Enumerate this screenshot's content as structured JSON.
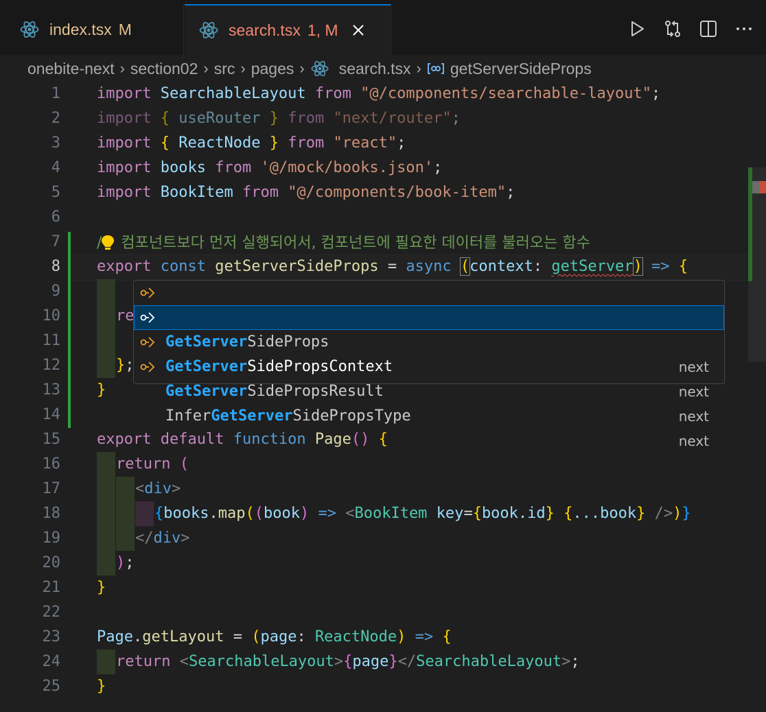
{
  "tabs": [
    {
      "name": "index.tsx",
      "status": "M"
    },
    {
      "name": "search.tsx",
      "status": "1, M"
    }
  ],
  "breadcrumb": [
    "onebite-next",
    "section02",
    "src",
    "pages",
    "search.tsx",
    "getServerSideProps"
  ],
  "editor": {
    "line_numbers": [
      "1",
      "2",
      "3",
      "4",
      "5",
      "6",
      "7",
      "8",
      "9",
      "10",
      "11",
      "12",
      "13",
      "14",
      "15",
      "16",
      "17",
      "18",
      "19",
      "20",
      "21",
      "22",
      "23",
      "24",
      "25"
    ],
    "line1": {
      "kw": "import",
      "name": "SearchableLayout",
      "from": "from",
      "path": "\"@/components/searchable-layout\"",
      "semi": ";"
    },
    "line2": {
      "kw": "import",
      "open": "{",
      "name": "useRouter",
      "close": "}",
      "from": "from",
      "path": "\"next/router\"",
      "semi": ";"
    },
    "line3": {
      "kw": "import",
      "open": "{",
      "name": "ReactNode",
      "close": "}",
      "from": "from",
      "path": "\"react\"",
      "semi": ";"
    },
    "line4": {
      "kw": "import",
      "name": "books",
      "from": "from",
      "path": "'@/mock/books.json'",
      "semi": ";"
    },
    "line5": {
      "kw": "import",
      "name": "BookItem",
      "from": "from",
      "path": "\"@/components/book-item\"",
      "semi": ";"
    },
    "line7": {
      "comment_prefix": "/",
      "comment": "컴포넌트보다 먼저 실행되어서, 컴포넌트에 필요한 데이터를 불러오는 함수"
    },
    "line8": {
      "export": "export",
      "const": "const",
      "name": "getServerSideProps",
      "eq": "=",
      "async": "async",
      "open": "(",
      "param": "context",
      "colon": ":",
      "typed": "getServer",
      "close": ")",
      "arrow": "=>",
      "brace": "{"
    },
    "line10": {
      "text": "re"
    },
    "line12": {
      "brace": "}",
      "semi": ";"
    },
    "line13": {
      "brace": "}"
    },
    "line15": {
      "export": "export",
      "default": "default",
      "function": "function",
      "name": "Page",
      "parens": "()",
      "brace": "{"
    },
    "line16": {
      "ret": "return",
      "open": "("
    },
    "line17": {
      "lt": "<",
      "tag": "div",
      "gt": ">"
    },
    "line18": {
      "ob": "{",
      "books": "books",
      "dot": ".",
      "map": "map",
      "p1": "(",
      "p2": "(",
      "book": "book",
      "p3": ")",
      "arrow": "=>",
      "lt": "<",
      "comp": "BookItem",
      "attr": "key",
      "eq": "=",
      "ob2": "{",
      "bid": "book.id",
      "cb2": "}",
      "ob3": "{",
      "spread": "...book",
      "cb3": "}",
      "selfclose": "/>",
      "p4": ")",
      "cb": "}"
    },
    "line19": {
      "open": "</",
      "tag": "div",
      "gt": ">"
    },
    "line20": {
      "close": ")",
      "semi": ";"
    },
    "line21": {
      "brace": "}"
    },
    "line23": {
      "obj": "Page",
      "dot": ".",
      "prop": "getLayout",
      "eq": "=",
      "open": "(",
      "param": "page",
      "colon": ":",
      "type": "ReactNode",
      "close": ")",
      "arrow": "=>",
      "brace": "{"
    },
    "line24": {
      "ret": "return",
      "lt": "<",
      "comp": "SearchableLayout",
      "gt": ">",
      "ob": "{",
      "page": "page",
      "cb": "}",
      "lt2": "</",
      "comp2": "SearchableLayout",
      "gt2": ">",
      "semi": ";"
    },
    "line25": {
      "brace": "}"
    }
  },
  "suggestions": [
    {
      "match": "GetServer",
      "rest": "SideProps",
      "prefix": "",
      "detail": "next",
      "selected": false
    },
    {
      "match": "GetServer",
      "rest": "SidePropsContext",
      "prefix": "",
      "detail": "next",
      "selected": true
    },
    {
      "match": "GetServer",
      "rest": "SidePropsResult",
      "prefix": "",
      "detail": "next",
      "selected": false
    },
    {
      "match": "GetServer",
      "rest": "SidePropsType",
      "prefix": "Infer",
      "detail": "next",
      "selected": false
    }
  ],
  "colors": {
    "accent": "#0078d4",
    "modified": "#e2c08d",
    "error": "#f48771",
    "gutter_added": "#2ea043",
    "react_icon": "#519aba"
  },
  "icons": [
    "react-icon",
    "close-icon",
    "run-icon",
    "source-control-icon",
    "split-editor-icon",
    "more-icon",
    "symbol-method-icon",
    "chevron-right-icon",
    "lightbulb-icon",
    "interface-icon"
  ]
}
